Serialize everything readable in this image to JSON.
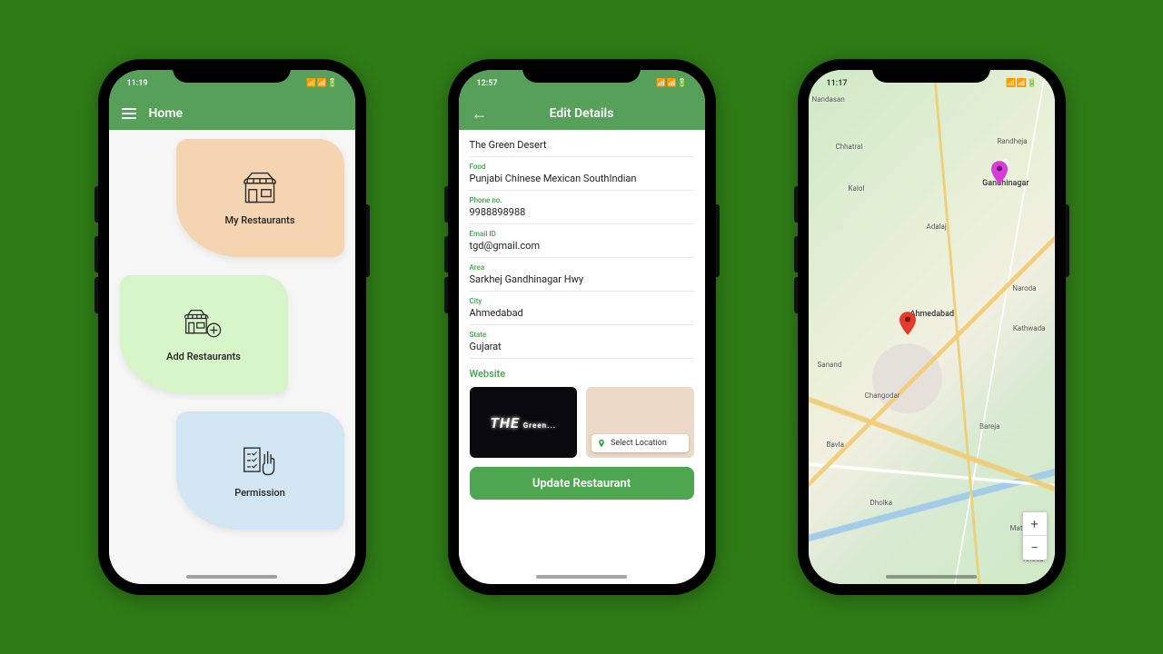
{
  "bg_color": "#2f7b16",
  "phone1": {
    "time": "11:19",
    "status_icons": "📶 📶 🔋",
    "appbar_title": "Home",
    "cards": [
      {
        "label": "My Restaurants"
      },
      {
        "label": "Add Restaurants"
      },
      {
        "label": "Permission"
      }
    ]
  },
  "phone2": {
    "time": "12:57",
    "status_icons": "📶 📶 🔋",
    "appbar_title": "Edit Details",
    "fields": {
      "name_value": "The Green Desert",
      "food_label": "Food",
      "food_value": "Punjabi Chinese Mexican SouthIndian",
      "phone_label": "Phone no.",
      "phone_value": "9988898988",
      "email_label": "Email ID",
      "email_value": "tgd@gmail.com",
      "area_label": "Area",
      "area_value": "Sarkhej Gandhinagar Hwy",
      "city_label": "City",
      "city_value": "Ahmedabad",
      "state_label": "State",
      "state_value": "Gujarat"
    },
    "website_link": "Website",
    "sign_main": "THE",
    "sign_sub": "Green...",
    "select_location": "Select Location",
    "update_button": "Update Restaurant"
  },
  "phone3": {
    "time": "11:17",
    "status_icons": "📶 📶 🔋",
    "labels": {
      "gandhinagar": "Gandhinagar",
      "ahmedabad": "Ahmedabad",
      "nandasan": "Nandasan",
      "chhatral": "Chhatral",
      "kalol": "Kalol",
      "randheja": "Randheja",
      "adalaj": "Adalaj",
      "naroda": "Naroda",
      "kathwada": "Kathwada",
      "sanand": "Sanand",
      "changodar": "Changodar",
      "dholka": "Dholka",
      "bavla": "Bavla",
      "bareja": "Bareja",
      "matar": "Matar",
      "kheda": "Kheda"
    },
    "zoom_in": "+",
    "zoom_out": "−"
  }
}
